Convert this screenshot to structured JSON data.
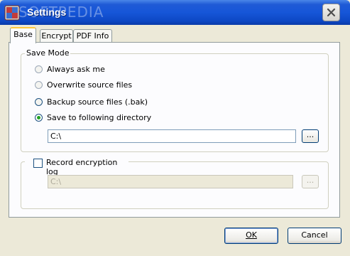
{
  "window": {
    "title": "Settings",
    "watermark": "SOFTPEDIA",
    "title_color": "#1656d8",
    "icons": {
      "app": "app-settings-icon",
      "close": "close-icon"
    }
  },
  "tabs": [
    {
      "label": "Base",
      "active": true
    },
    {
      "label": "Encrypt",
      "active": false
    },
    {
      "label": "PDF Info",
      "active": false
    }
  ],
  "save_mode": {
    "title": "Save Mode",
    "options": [
      {
        "label": "Always ask me",
        "selected": false
      },
      {
        "label": "Overwrite source files",
        "selected": false
      },
      {
        "label": "Backup source files (.bak)",
        "selected": false
      },
      {
        "label": "Save to following directory",
        "selected": true
      }
    ],
    "directory_value": "C:\\",
    "browse_label": "..."
  },
  "encryption_log": {
    "label": "Record encryption log",
    "checked": false,
    "path_value": "C:\\",
    "browse_label": "..."
  },
  "footer": {
    "ok_label": "OK",
    "cancel_label": "Cancel"
  }
}
